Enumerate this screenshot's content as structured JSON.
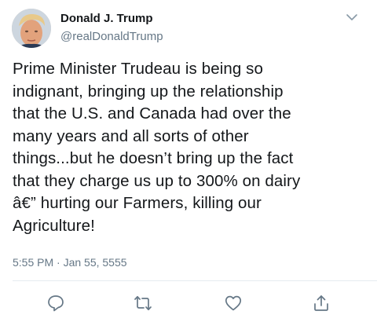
{
  "tweet": {
    "author_name": "Donald J. Trump",
    "author_handle": "@realDonaldTrump",
    "text": "Prime Minister Trudeau is being so\nindignant, bringing up the relationship\nthat the U.S. and Canada had over the\nmany years and all sorts of other\nthings...but he doesn’t bring up the fact\nthat they charge us up to 300% on dairy\nâ€” hurting our Farmers, killing our\nAgriculture!",
    "timestamp": "5:55 PM · Jan 55, 5555"
  },
  "icons": {
    "menu": "chevron-down-icon",
    "reply": "reply-icon",
    "retweet": "retweet-icon",
    "like": "heart-icon",
    "share": "share-icon"
  },
  "colors": {
    "text": "#14171a",
    "secondary": "#657786",
    "icon": "#657786",
    "divider": "#e6ecf0"
  }
}
